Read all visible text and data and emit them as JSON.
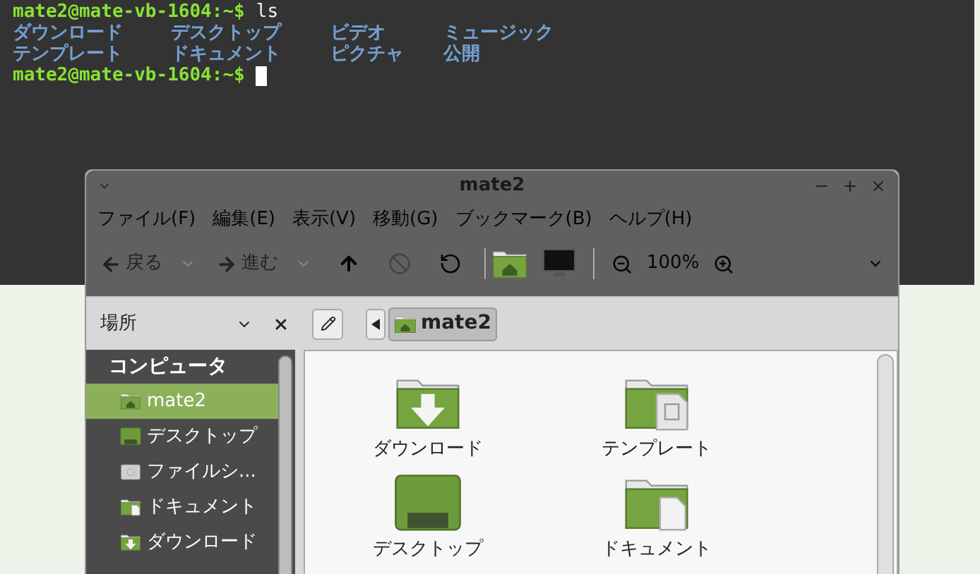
{
  "terminal": {
    "lines": [
      {
        "kind": "prompt",
        "prompt": "mate2@mate-vb-1604:~$",
        "command": "ls",
        "cursor": false
      },
      {
        "kind": "output",
        "columns": [
          "ダウンロード",
          "デスクトップ",
          "ビデオ",
          "ミュージック"
        ]
      },
      {
        "kind": "output",
        "columns": [
          "テンプレート",
          "ドキュメント",
          "ピクチャ",
          "公開"
        ]
      },
      {
        "kind": "prompt",
        "prompt": "mate2@mate-vb-1604:~$",
        "cursor": true
      }
    ]
  },
  "file_manager": {
    "title": "mate2",
    "menu": [
      "ファイル(F)",
      "編集(E)",
      "表示(V)",
      "移動(G)",
      "ブックマーク(B)",
      "ヘルプ(H)"
    ],
    "toolbar": {
      "back": {
        "label": "戻る",
        "disabled": true
      },
      "forward": {
        "label": "進む",
        "disabled": true
      },
      "zoom": "100%"
    },
    "sidebar": {
      "title": "場所",
      "section": "コンピュータ",
      "items": [
        {
          "label": "mate2",
          "kind": "home",
          "selected": true
        },
        {
          "label": "デスクトップ",
          "kind": "desktop",
          "selected": false
        },
        {
          "label": "ファイルシ...",
          "kind": "drive",
          "selected": false
        },
        {
          "label": "ドキュメント",
          "kind": "documents",
          "selected": false
        },
        {
          "label": "ダウンロード",
          "kind": "downloads",
          "selected": false
        }
      ]
    },
    "path": [
      "mate2"
    ],
    "files": [
      {
        "name": "ダウンロード",
        "kind": "downloads"
      },
      {
        "name": "テンプレート",
        "kind": "templates"
      },
      {
        "name": "デスクトップ",
        "kind": "desktop"
      },
      {
        "name": "ドキュメント",
        "kind": "documents"
      }
    ]
  }
}
